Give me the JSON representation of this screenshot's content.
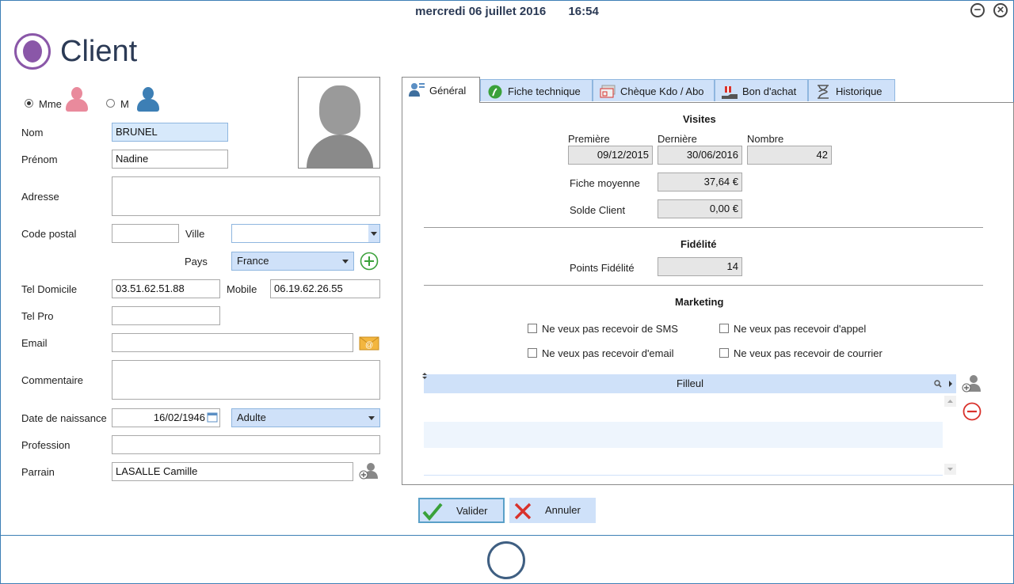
{
  "header": {
    "date": "mercredi 06 juillet 2016",
    "time": "16:54"
  },
  "window": {
    "minimize_glyph": "−",
    "close_glyph": "×"
  },
  "page_title": "Client",
  "colors": {
    "accent": "#cfe1f9",
    "brand": "#8a57a8",
    "female": "#e98a9c",
    "male": "#3d7fb5",
    "add": "#3aa13a",
    "remove": "#d9312b"
  },
  "gender": {
    "mme_label": "Mme",
    "m_label": "M",
    "selected": "Mme"
  },
  "form": {
    "nom": {
      "label": "Nom",
      "value": "BRUNEL"
    },
    "prenom": {
      "label": "Prénom",
      "value": "Nadine"
    },
    "adresse": {
      "label": "Adresse",
      "value": ""
    },
    "code_postal": {
      "label": "Code postal",
      "value": ""
    },
    "ville": {
      "label": "Ville",
      "value": ""
    },
    "pays": {
      "label": "Pays",
      "value": "France"
    },
    "tel_domicile": {
      "label": "Tel Domicile",
      "value": "03.51.62.51.88"
    },
    "mobile": {
      "label": "Mobile",
      "value": "06.19.62.26.55"
    },
    "tel_pro": {
      "label": "Tel Pro",
      "value": ""
    },
    "email": {
      "label": "Email",
      "value": ""
    },
    "commentaire": {
      "label": "Commentaire",
      "value": ""
    },
    "date_naissance": {
      "label": "Date de naissance",
      "value": "16/02/1946"
    },
    "categorie": {
      "value": "Adulte"
    },
    "profession": {
      "label": "Profession",
      "value": ""
    },
    "parrain": {
      "label": "Parrain",
      "value": "LASALLE Camille"
    }
  },
  "tabs": [
    {
      "label": "Général",
      "icon": "user-card-icon",
      "active": true
    },
    {
      "label": "Fiche technique",
      "icon": "hair-dryer-icon"
    },
    {
      "label": "Chèque Kdo / Abo",
      "icon": "gift-card-icon"
    },
    {
      "label": "Bon d'achat",
      "icon": "gift-box-icon"
    },
    {
      "label": "Historique",
      "icon": "history-icon"
    }
  ],
  "general": {
    "visites_title": "Visites",
    "premiere_label": "Première",
    "premiere_value": "09/12/2015",
    "derniere_label": "Dernière",
    "derniere_value": "30/06/2016",
    "nombre_label": "Nombre",
    "nombre_value": "42",
    "fiche_moyenne_label": "Fiche moyenne",
    "fiche_moyenne_value": "37,64 €",
    "solde_label": "Solde Client",
    "solde_value": "0,00 €",
    "fidelite_title": "Fidélité",
    "points_label": "Points Fidélité",
    "points_value": "14",
    "marketing_title": "Marketing",
    "no_sms": "Ne veux pas recevoir de SMS",
    "no_appel": "Ne veux pas recevoir d'appel",
    "no_email": "Ne veux pas recevoir d'email",
    "no_courrier": "Ne veux pas recevoir de courrier",
    "filleul_header": "Filleul"
  },
  "actions": {
    "valider": "Valider",
    "annuler": "Annuler"
  }
}
